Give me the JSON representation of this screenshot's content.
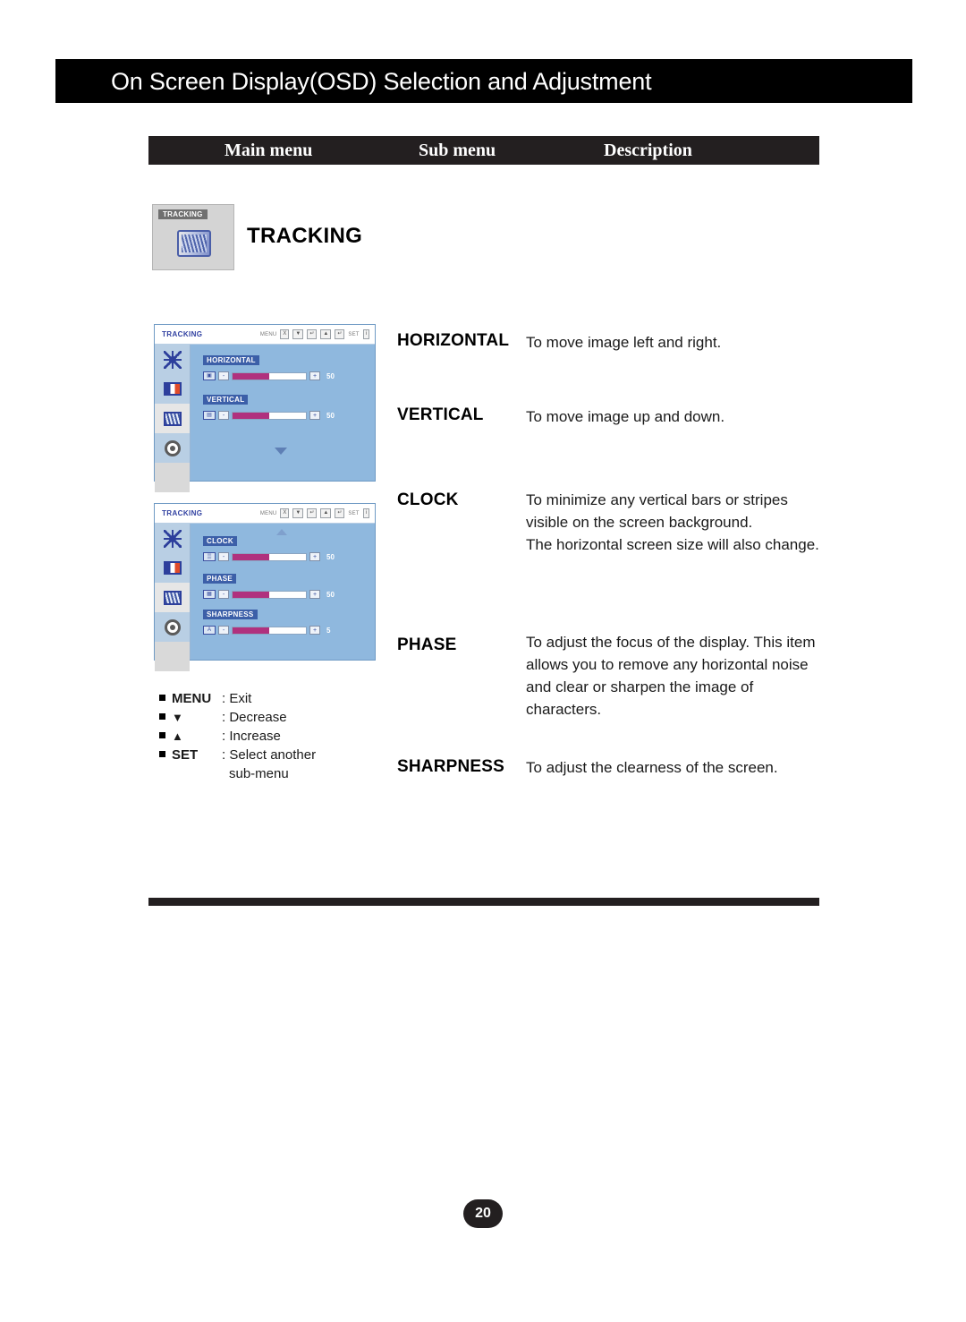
{
  "header": {
    "title": "On Screen Display(OSD) Selection and Adjustment"
  },
  "columns": {
    "main": "Main menu",
    "sub": "Sub menu",
    "description": "Description"
  },
  "main_menu": {
    "icon_label": "TRACKING",
    "title": "TRACKING"
  },
  "osd1": {
    "title": "TRACKING",
    "keys": {
      "menu": "MENU",
      "menu_box": "X",
      "down_box": "▼",
      "down_box2": "↵",
      "up_box": "▲",
      "up_box2": "↵",
      "set": "SET",
      "set_box": "□",
      "info_box": "i"
    },
    "rows": [
      {
        "label": "HORIZONTAL",
        "icon": "▣",
        "value": "50",
        "fill_pct": 50
      },
      {
        "label": "VERTICAL",
        "icon": "▤",
        "value": "50",
        "fill_pct": 50
      }
    ],
    "scroll_hint": "arrow-down"
  },
  "osd2": {
    "title": "TRACKING",
    "rows": [
      {
        "label": "CLOCK",
        "icon": "▒",
        "value": "50",
        "fill_pct": 50
      },
      {
        "label": "PHASE",
        "icon": "▦",
        "value": "50",
        "fill_pct": 50
      },
      {
        "label": "SHARPNESS",
        "icon": "A",
        "value": "5",
        "fill_pct": 50
      }
    ],
    "scroll_hint": "arrow-up"
  },
  "legend": [
    {
      "key": "MENU",
      "sep": ": ",
      "text": "Exit"
    },
    {
      "key": "▼",
      "sep": ": ",
      "text": "Decrease"
    },
    {
      "key": "▲",
      "sep": ": ",
      "text": "Increase"
    },
    {
      "key": "SET",
      "sep": ": ",
      "text": "Select another",
      "text2": "sub-menu"
    }
  ],
  "entries": [
    {
      "term": "HORIZONTAL",
      "desc": "To move image left and right."
    },
    {
      "term": "VERTICAL",
      "desc": "To move image up and down."
    },
    {
      "term": "CLOCK",
      "desc": "To minimize any vertical bars or stripes visible on the screen background.\nThe horizontal screen size will also change."
    },
    {
      "term": "PHASE",
      "desc": "To adjust the focus of the display. This item allows you to remove any horizontal noise and clear or sharpen the image of characters."
    },
    {
      "term": "SHARPNESS",
      "desc": "To adjust the clearness of the screen."
    }
  ],
  "footer": {
    "page_number": "20"
  },
  "colors": {
    "header_bg": "#000000",
    "table_head_bg": "#231f20",
    "osd_bg": "#8fb8de",
    "osd_accent": "#b0317e",
    "osd_label_bg": "#3c5fa8"
  }
}
